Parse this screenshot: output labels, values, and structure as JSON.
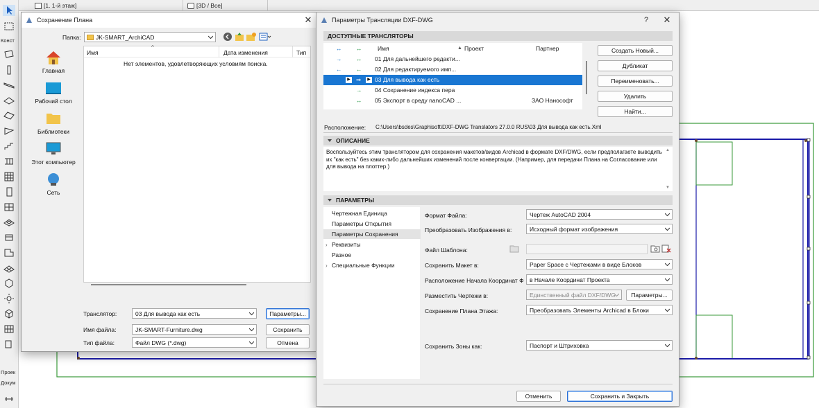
{
  "tabs": [
    {
      "label": "[1. 1-й этаж]"
    },
    {
      "label": "[3D / Все]"
    }
  ],
  "toolbox": {
    "section_labels": [
      "Конст",
      "Проек",
      "Докум"
    ]
  },
  "save_dialog": {
    "title": "Сохранение Плана",
    "folder_label": "Папка:",
    "folder_value": "JK-SMART_ArchiCAD",
    "places": [
      {
        "label": "Главная",
        "icon": "home-icon"
      },
      {
        "label": "Рабочий стол",
        "icon": "desktop-icon"
      },
      {
        "label": "Библиотеки",
        "icon": "folder-icon"
      },
      {
        "label": "Этот компьютер",
        "icon": "computer-icon"
      },
      {
        "label": "Сеть",
        "icon": "network-icon"
      }
    ],
    "columns": {
      "name": "Имя",
      "date": "Дата изменения",
      "type": "Тип"
    },
    "empty_message": "Нет элементов, удовлетворяющих условиям поиска.",
    "translator_label": "Транслятор:",
    "translator_value": "03 Для вывода как есть",
    "filename_label": "Имя файла:",
    "filename_value": "JK-SMART-Furniture.dwg",
    "filetype_label": "Тип файла:",
    "filetype_value": "Файл DWG (*.dwg)",
    "params_button": "Параметры...",
    "save_button": "Сохранить",
    "cancel_button": "Отмена"
  },
  "translator_dialog": {
    "title": "Параметры Трансляции DXF-DWG",
    "help": "?",
    "close": "✕",
    "available_header": "ДОСТУПНЫЕ ТРАНСЛЯТОРЫ",
    "columns": {
      "name": "Имя",
      "project": "Проект",
      "partner": "Партнер"
    },
    "translators": [
      {
        "name": "01 Для дальнейшего редакти...",
        "project": "",
        "partner": ""
      },
      {
        "name": "02 Для редактируемого имп...",
        "project": "",
        "partner": ""
      },
      {
        "name": "03 Для вывода как есть",
        "project": "",
        "partner": ""
      },
      {
        "name": "04 Сохранение индекса пера",
        "project": "",
        "partner": ""
      },
      {
        "name": "05 Экспорт в среду nanoCAD ...",
        "project": "",
        "partner": "ЗАО Нанософт"
      }
    ],
    "selected_index": 2,
    "buttons": {
      "create": "Создать Новый...",
      "duplicate": "Дубликат",
      "rename": "Переименовать...",
      "delete": "Удалить",
      "find": "Найти..."
    },
    "location_label": "Расположение:",
    "location_value": "C:\\Users\\bsdes\\Graphisoft\\DXF-DWG Translators 27.0.0 RUS\\03 Для вывода как есть.Xml",
    "description_header": "ОПИСАНИЕ",
    "description_text": "Воспользуйтесь этим транслятором для сохранения макетов/видов Archicad в формате DXF/DWG, если предполагаете выводить их \"как есть\" без каких-либо дальнейших изменений после конвертации. (Например, для передачи Плана на Согласование или для вывода на плоттер.)",
    "params_header": "ПАРАМЕТРЫ",
    "tree": [
      {
        "label": "Чертежная Единица",
        "expandable": false
      },
      {
        "label": "Параметры Открытия",
        "expandable": false
      },
      {
        "label": "Параметры Сохранения",
        "expandable": false
      },
      {
        "label": "Реквизиты",
        "expandable": true
      },
      {
        "label": "Разное",
        "expandable": false
      },
      {
        "label": "Специальные Функции",
        "expandable": true
      }
    ],
    "tree_selected_index": 2,
    "settings": {
      "file_format_label": "Формат Файла:",
      "file_format_value": "Чертеж AutoCAD 2004",
      "convert_images_label": "Преобразовать Изображения в:",
      "convert_images_value": "Исходный формат изображения",
      "template_label": "Файл Шаблона:",
      "template_value": "",
      "save_layout_label": "Сохранить Макет в:",
      "save_layout_value": "Paper Space с Чертежами в виде Блоков",
      "origin_label": "Расположение Начала Координат Фа",
      "origin_value": "в Начале Координат Проекта",
      "place_drawings_label": "Разместить Чертежи в:",
      "place_drawings_value": "Единственный файл DXF/DWG",
      "place_params_button": "Параметры...",
      "save_floor_label": "Сохранение Плана Этажа:",
      "save_floor_value": "Преобразовать Элементы Archicad в Блоки",
      "save_zones_label": "Сохранить Зоны как:",
      "save_zones_value": "Паспорт и Штриховка"
    },
    "cancel_button": "Отменить",
    "save_close_button": "Сохранить и Закрыть"
  },
  "colors": {
    "selection": "#1976d2",
    "plan_green": "#3a9a3a",
    "plan_blue": "#1a1aa8"
  }
}
